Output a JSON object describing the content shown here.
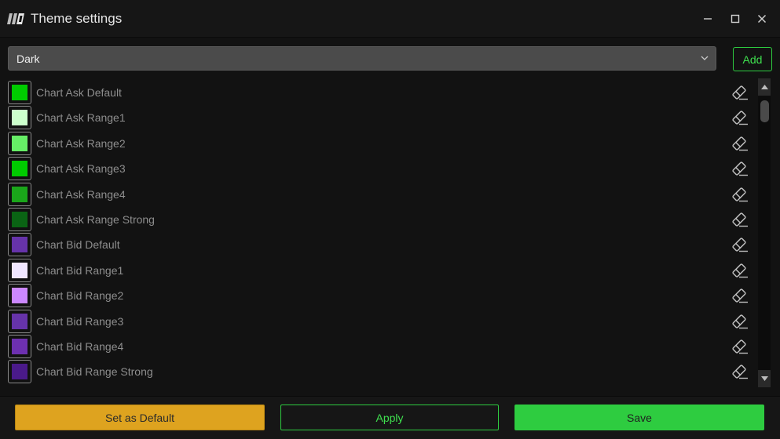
{
  "window": {
    "title": "Theme settings",
    "logo_icon": "app-logo-icon",
    "controls": [
      "minimize-icon",
      "maximize-icon",
      "close-icon"
    ]
  },
  "theme_select": {
    "value": "Dark",
    "icon": "chevron-down-icon"
  },
  "add_label": "Add",
  "colors": {
    "accent_green": "#2ecc40",
    "accent_yellow": "#dea31f"
  },
  "items": [
    {
      "label": "Chart Ask Default",
      "color": "#00cc00"
    },
    {
      "label": "Chart Ask Range1",
      "color": "#ccffcc"
    },
    {
      "label": "Chart Ask Range2",
      "color": "#66ee66"
    },
    {
      "label": "Chart Ask Range3",
      "color": "#00cc00"
    },
    {
      "label": "Chart Ask Range4",
      "color": "#1aa61a"
    },
    {
      "label": "Chart Ask Range Strong",
      "color": "#0a6414"
    },
    {
      "label": "Chart Bid Default",
      "color": "#6633aa"
    },
    {
      "label": "Chart Bid Range1",
      "color": "#f0e6ff"
    },
    {
      "label": "Chart Bid Range2",
      "color": "#cc88ff"
    },
    {
      "label": "Chart Bid Range3",
      "color": "#6633aa"
    },
    {
      "label": "Chart Bid Range4",
      "color": "#6d30b0"
    },
    {
      "label": "Chart Bid Range Strong",
      "color": "#4a1a8a"
    }
  ],
  "footer": {
    "set_default_label": "Set as Default",
    "apply_label": "Apply",
    "save_label": "Save"
  }
}
